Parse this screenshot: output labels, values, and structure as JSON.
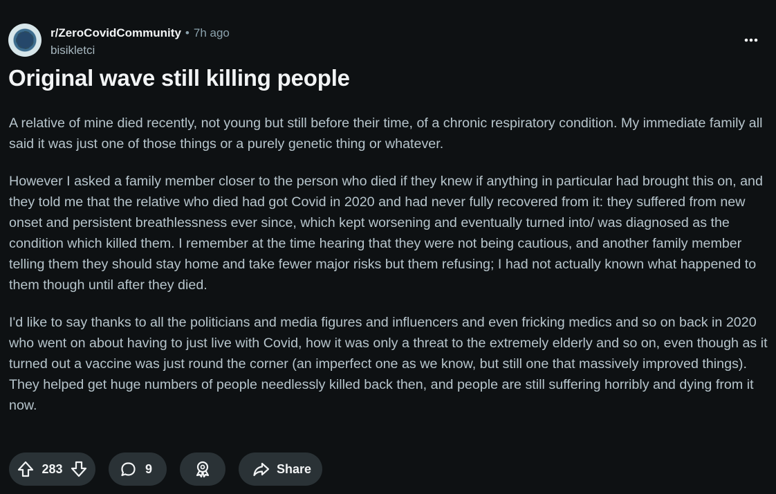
{
  "post": {
    "subreddit": "r/ZeroCovidCommunity",
    "separator": "•",
    "time": "7h ago",
    "author": "bisikletci",
    "title": "Original wave still killing people",
    "paragraphs": [
      "A relative of mine died recently, not young but still before their time, of a chronic respiratory condition. My immediate family all said it was just one of those things or a purely genetic thing or whatever.",
      "However I asked a family member closer to the person who died if they knew if anything in particular had brought this on, and they told me that the relative who died had got Covid in 2020 and had never fully recovered from it: they suffered from new onset and persistent breathlessness ever since, which kept worsening and eventually turned into/ was diagnosed as the condition which killed them. I remember at the time hearing that they were not being cautious, and another family member telling them they should stay home and take fewer major risks but them refusing; I had not actually known what happened to them though until after they died.",
      "I'd like to say thanks to all the politicians and media figures and influencers and even fricking medics and so on back in 2020 who went on about having to just live with Covid, how it was only a threat to the extremely elderly and so on, even though as it turned out a vaccine was just round the corner (an imperfect one as we know, but still one that massively improved things). They helped get huge numbers of people needlessly killed back then, and people are still suffering horribly and dying from it now."
    ]
  },
  "actions": {
    "votes": "283",
    "comments": "9",
    "share_label": "Share"
  },
  "icons": {
    "subreddit_avatar": "virus-globe-avatar",
    "more": "more-horizontal-icon",
    "upvote": "arrow-up-icon",
    "downvote": "arrow-down-icon",
    "comment": "comment-bubble-icon",
    "award": "award-icon",
    "share": "share-arrow-icon"
  },
  "colors": {
    "background": "#0e1113",
    "button_background": "#2a3236",
    "primary_text": "#f2f4f5",
    "body_text": "#b7c5cc",
    "muted_text": "#8ba2ad"
  }
}
